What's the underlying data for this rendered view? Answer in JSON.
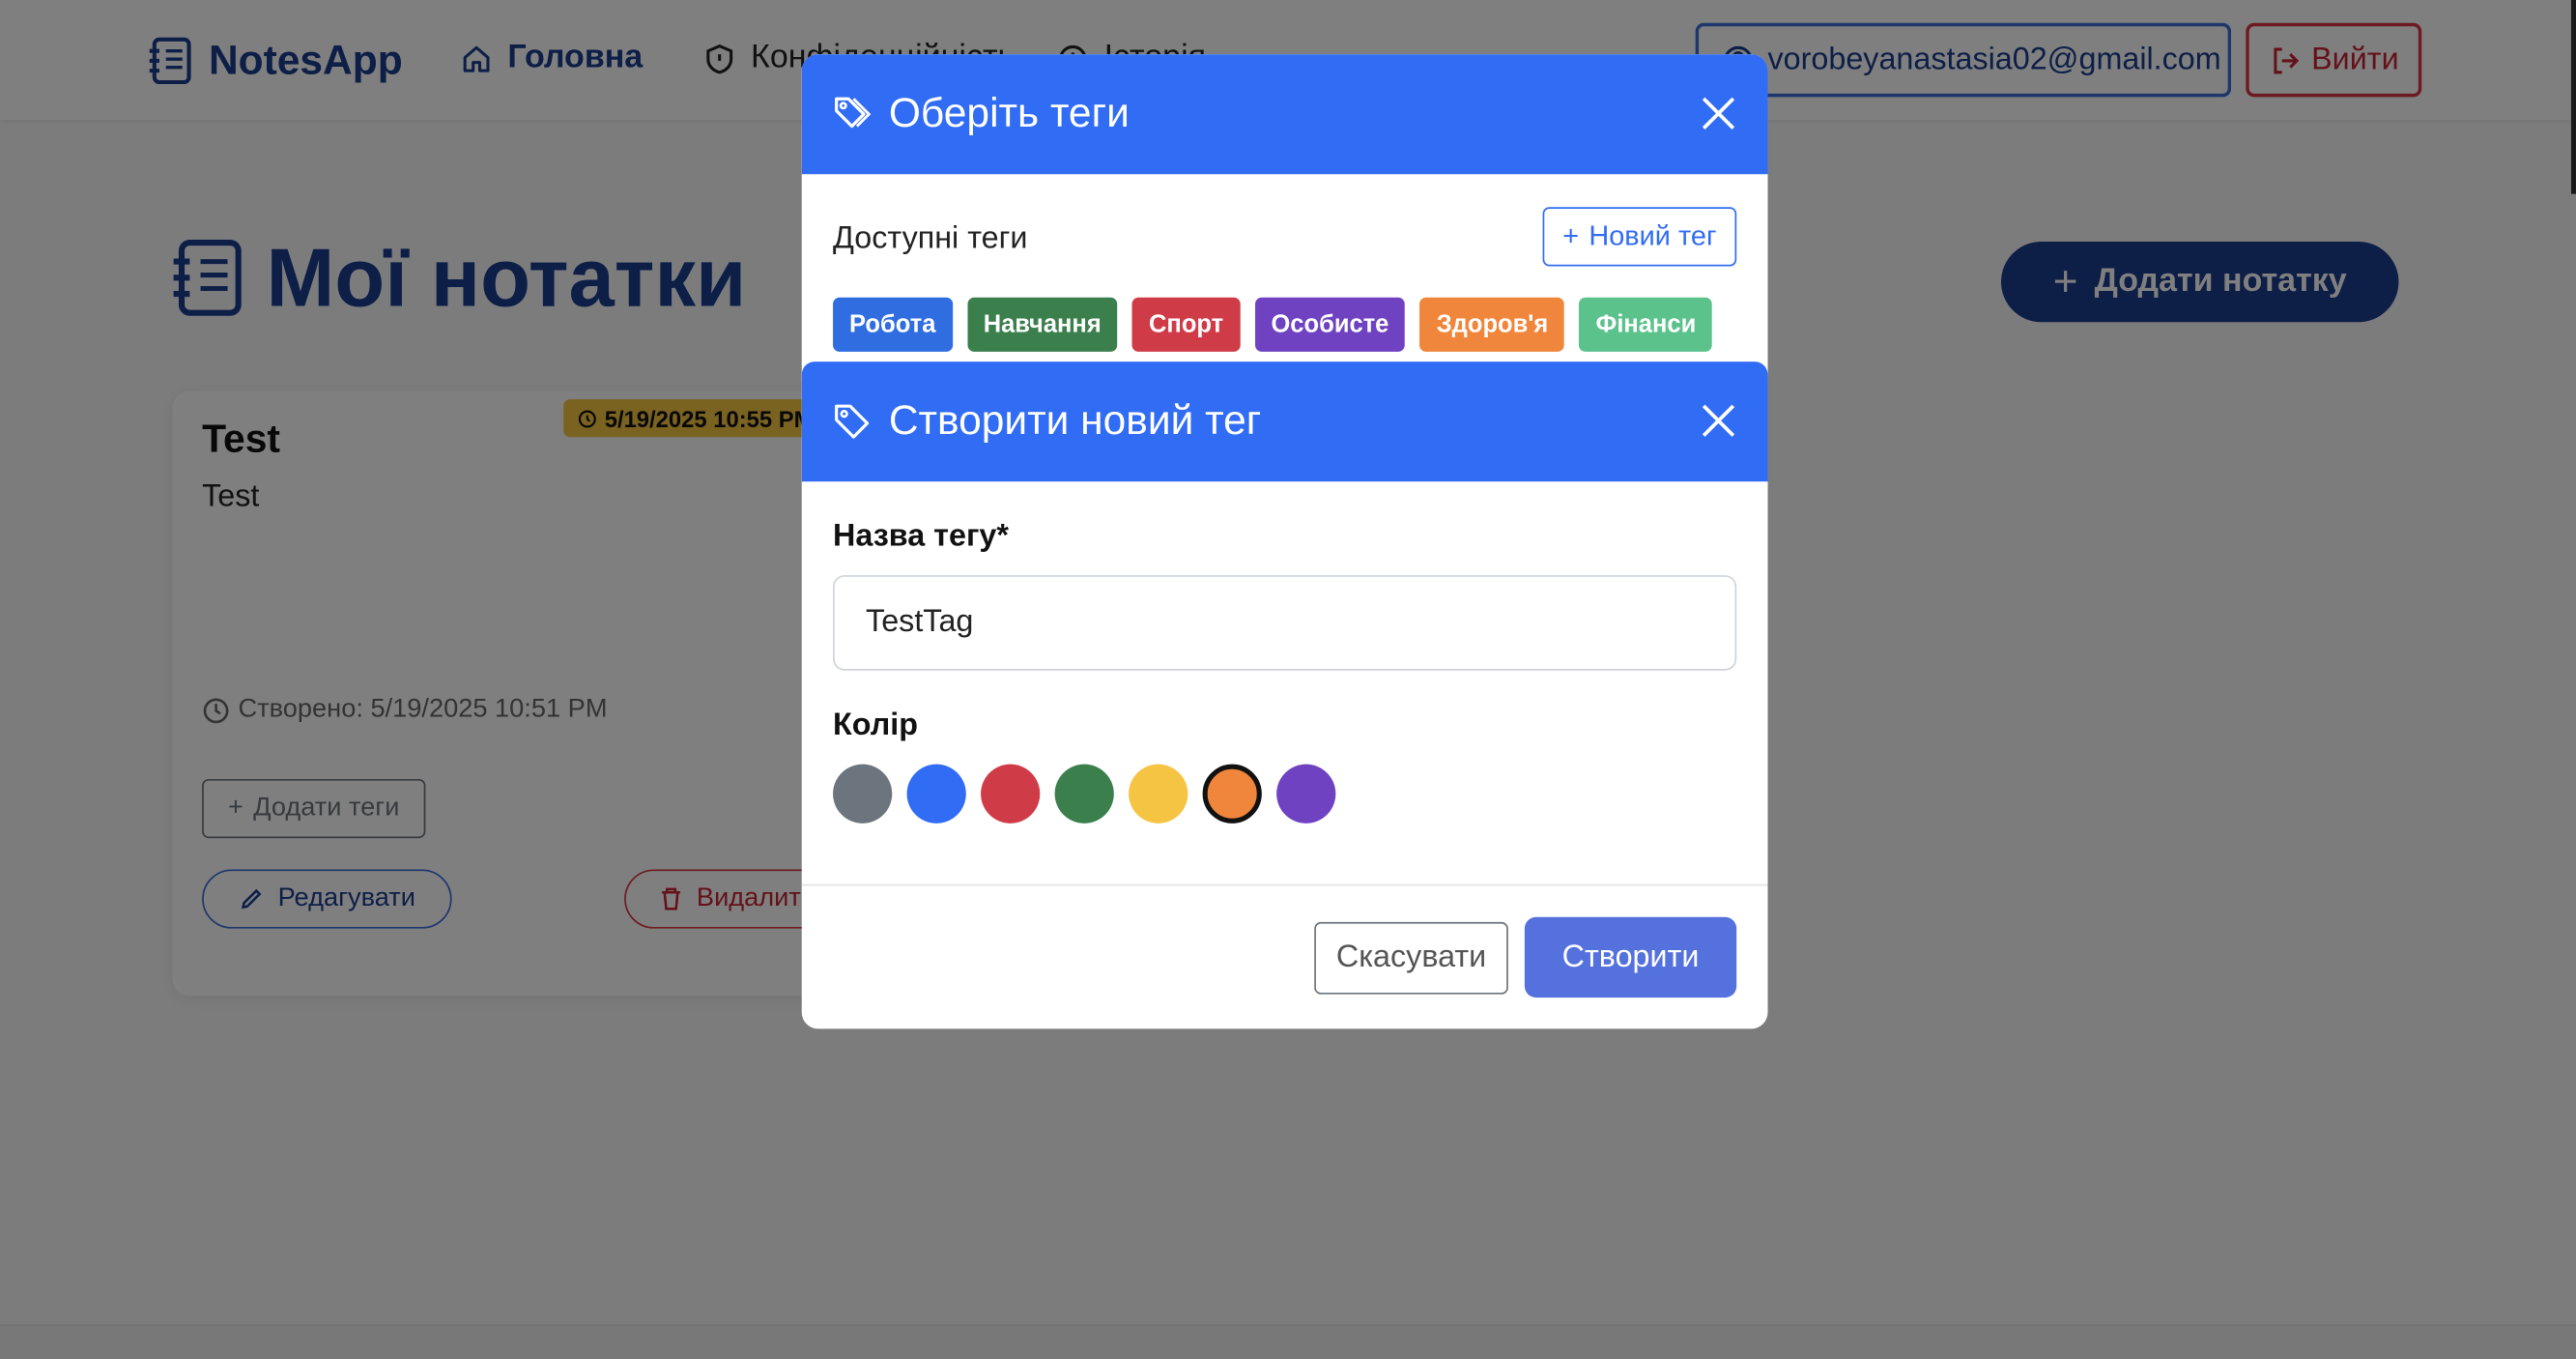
{
  "navbar": {
    "brand": "NotesApp",
    "home": "Головна",
    "privacy": "Конфіденційність",
    "history": "Історія",
    "email": "vorobeyanastasia02@gmail.com",
    "logout": "Вийти"
  },
  "page": {
    "title": "Мої нотатки",
    "add_note": "Додати нотатку"
  },
  "note": {
    "title": "Test",
    "body": "Test",
    "reminder": "5/19/2025 10:55 PM",
    "created": "Створено: 5/19/2025 10:51 PM",
    "add_tags": "Додати теги",
    "edit": "Редагувати",
    "delete": "Видалити"
  },
  "tags_modal": {
    "title": "Оберіть теги",
    "available_label": "Доступні теги",
    "new_tag": "Новий тег",
    "tags": [
      {
        "label": "Робота",
        "color": "#2f6de1"
      },
      {
        "label": "Навчання",
        "color": "#3b7f4d"
      },
      {
        "label": "Спорт",
        "color": "#cf3c48"
      },
      {
        "label": "Особисте",
        "color": "#6f42c1"
      },
      {
        "label": "Здоров'я",
        "color": "#f0863b"
      },
      {
        "label": "Фінанси",
        "color": "#5bc28c"
      }
    ]
  },
  "create_modal": {
    "title": "Створити новий тег",
    "name_label": "Назва тегу*",
    "name_value": "TestTag",
    "color_label": "Колір",
    "colors": [
      "#6c757d",
      "#316cf4",
      "#cf3c48",
      "#3b7f4d",
      "#f6c443",
      "#f0863b",
      "#6f42c1"
    ],
    "selected_color": "#f0863b",
    "cancel": "Скасувати",
    "create": "Створити"
  }
}
